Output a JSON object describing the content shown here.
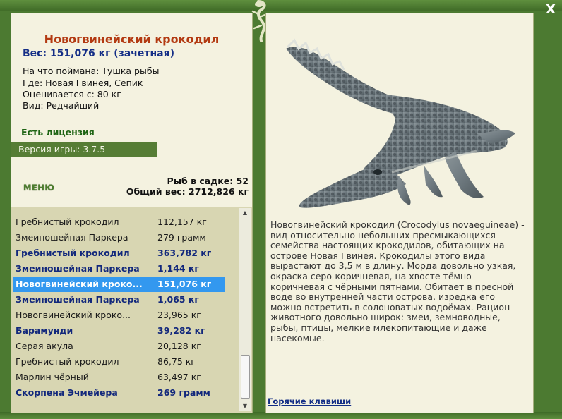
{
  "window": {
    "close_label": "X"
  },
  "fish": {
    "title": "Новогвинейский крокодил",
    "weight_line": "Вес: 151,076 кг (зачетная)",
    "caught_on_label": "На что поймана:",
    "caught_on_value": "Тушка рыбы",
    "where_label": "Где:",
    "where_value": "Новая Гвинея, Сепик",
    "valued_from_label": "Оценивается с:",
    "valued_from_value": "80 кг",
    "kind_label": "Вид:",
    "kind_value": "Редчайший"
  },
  "license_text": "Есть лицензия",
  "version_text": "Версия игры: 3.7.5",
  "menu_label": "МЕНЮ",
  "keepnet": {
    "fish_count_line": "Рыб в садке: 52",
    "total_weight_line": "Общий вес: 2712,826 кг"
  },
  "catch_list": [
    {
      "name": "Гребнистый крокодил",
      "weight": "112,157 кг",
      "style": "normal"
    },
    {
      "name": "Змеиношейная Паркера",
      "weight": "279 грамм",
      "style": "normal"
    },
    {
      "name": "Гребнистый крокодил",
      "weight": "363,782 кг",
      "style": "bold"
    },
    {
      "name": "Змеиношейная Паркера",
      "weight": "1,144 кг",
      "style": "bold"
    },
    {
      "name": "Новогвинейский кроко...",
      "weight": "151,076 кг",
      "style": "selected"
    },
    {
      "name": "Змеиношейная Паркера",
      "weight": "1,065 кг",
      "style": "bold"
    },
    {
      "name": "Новогвинейский кроко...",
      "weight": "23,965 кг",
      "style": "normal"
    },
    {
      "name": "Барамунди",
      "weight": "39,282 кг",
      "style": "bold"
    },
    {
      "name": "Серая акула",
      "weight": "20,128 кг",
      "style": "normal"
    },
    {
      "name": "Гребнистый крокодил",
      "weight": "86,75 кг",
      "style": "normal"
    },
    {
      "name": "Марлин чёрный",
      "weight": "63,497 кг",
      "style": "normal"
    },
    {
      "name": "Скорпена Эчмейера",
      "weight": "269 грамм",
      "style": "bold"
    }
  ],
  "description": "Новогвинейский крокодил (Crocodylus novaeguineae) - вид относительно небольших пресмыкающихся семейства настоящих крокодилов, обитающих на острове Новая Гвинея. Крокодилы этого вида вырастают до 3,5 м в длину. Морда довольно узкая, окраска серо-коричневая, на хвосте тёмно-коричневая с чёрными пятнами. Обитает в пресной воде во внутренней части острова, изредка его можно встретить в солоноватых водоёмах. Рацион животного довольно широк: змеи, земноводные, рыбы, птицы, мелкие млекопитающие и даже насекомые.",
  "hotkeys_label": "Горячие клавиши",
  "colors": {
    "frame": "#4c7a31",
    "panel_bg": "#f4f2e0",
    "list_bg": "#d8d6b2",
    "selected_row": "#3398ef",
    "title": "#b33a12",
    "bold_row": "#12287c",
    "license": "#1e6414"
  },
  "icons": {
    "close": "close-icon",
    "lizard": "lizard-ornament-icon",
    "crocodile": "crocodile-image"
  }
}
